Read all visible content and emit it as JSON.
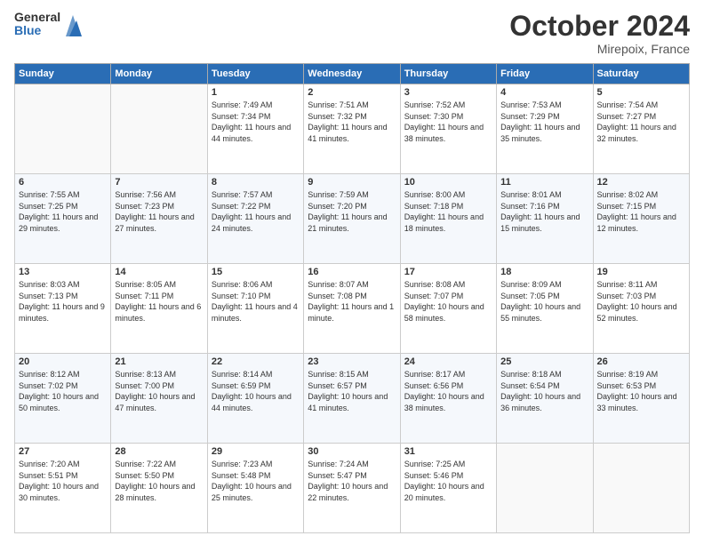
{
  "logo": {
    "general": "General",
    "blue": "Blue"
  },
  "header": {
    "month": "October 2024",
    "location": "Mirepoix, France"
  },
  "weekdays": [
    "Sunday",
    "Monday",
    "Tuesday",
    "Wednesday",
    "Thursday",
    "Friday",
    "Saturday"
  ],
  "weeks": [
    [
      {
        "day": "",
        "info": ""
      },
      {
        "day": "",
        "info": ""
      },
      {
        "day": "1",
        "info": "Sunrise: 7:49 AM\nSunset: 7:34 PM\nDaylight: 11 hours and 44 minutes."
      },
      {
        "day": "2",
        "info": "Sunrise: 7:51 AM\nSunset: 7:32 PM\nDaylight: 11 hours and 41 minutes."
      },
      {
        "day": "3",
        "info": "Sunrise: 7:52 AM\nSunset: 7:30 PM\nDaylight: 11 hours and 38 minutes."
      },
      {
        "day": "4",
        "info": "Sunrise: 7:53 AM\nSunset: 7:29 PM\nDaylight: 11 hours and 35 minutes."
      },
      {
        "day": "5",
        "info": "Sunrise: 7:54 AM\nSunset: 7:27 PM\nDaylight: 11 hours and 32 minutes."
      }
    ],
    [
      {
        "day": "6",
        "info": "Sunrise: 7:55 AM\nSunset: 7:25 PM\nDaylight: 11 hours and 29 minutes."
      },
      {
        "day": "7",
        "info": "Sunrise: 7:56 AM\nSunset: 7:23 PM\nDaylight: 11 hours and 27 minutes."
      },
      {
        "day": "8",
        "info": "Sunrise: 7:57 AM\nSunset: 7:22 PM\nDaylight: 11 hours and 24 minutes."
      },
      {
        "day": "9",
        "info": "Sunrise: 7:59 AM\nSunset: 7:20 PM\nDaylight: 11 hours and 21 minutes."
      },
      {
        "day": "10",
        "info": "Sunrise: 8:00 AM\nSunset: 7:18 PM\nDaylight: 11 hours and 18 minutes."
      },
      {
        "day": "11",
        "info": "Sunrise: 8:01 AM\nSunset: 7:16 PM\nDaylight: 11 hours and 15 minutes."
      },
      {
        "day": "12",
        "info": "Sunrise: 8:02 AM\nSunset: 7:15 PM\nDaylight: 11 hours and 12 minutes."
      }
    ],
    [
      {
        "day": "13",
        "info": "Sunrise: 8:03 AM\nSunset: 7:13 PM\nDaylight: 11 hours and 9 minutes."
      },
      {
        "day": "14",
        "info": "Sunrise: 8:05 AM\nSunset: 7:11 PM\nDaylight: 11 hours and 6 minutes."
      },
      {
        "day": "15",
        "info": "Sunrise: 8:06 AM\nSunset: 7:10 PM\nDaylight: 11 hours and 4 minutes."
      },
      {
        "day": "16",
        "info": "Sunrise: 8:07 AM\nSunset: 7:08 PM\nDaylight: 11 hours and 1 minute."
      },
      {
        "day": "17",
        "info": "Sunrise: 8:08 AM\nSunset: 7:07 PM\nDaylight: 10 hours and 58 minutes."
      },
      {
        "day": "18",
        "info": "Sunrise: 8:09 AM\nSunset: 7:05 PM\nDaylight: 10 hours and 55 minutes."
      },
      {
        "day": "19",
        "info": "Sunrise: 8:11 AM\nSunset: 7:03 PM\nDaylight: 10 hours and 52 minutes."
      }
    ],
    [
      {
        "day": "20",
        "info": "Sunrise: 8:12 AM\nSunset: 7:02 PM\nDaylight: 10 hours and 50 minutes."
      },
      {
        "day": "21",
        "info": "Sunrise: 8:13 AM\nSunset: 7:00 PM\nDaylight: 10 hours and 47 minutes."
      },
      {
        "day": "22",
        "info": "Sunrise: 8:14 AM\nSunset: 6:59 PM\nDaylight: 10 hours and 44 minutes."
      },
      {
        "day": "23",
        "info": "Sunrise: 8:15 AM\nSunset: 6:57 PM\nDaylight: 10 hours and 41 minutes."
      },
      {
        "day": "24",
        "info": "Sunrise: 8:17 AM\nSunset: 6:56 PM\nDaylight: 10 hours and 38 minutes."
      },
      {
        "day": "25",
        "info": "Sunrise: 8:18 AM\nSunset: 6:54 PM\nDaylight: 10 hours and 36 minutes."
      },
      {
        "day": "26",
        "info": "Sunrise: 8:19 AM\nSunset: 6:53 PM\nDaylight: 10 hours and 33 minutes."
      }
    ],
    [
      {
        "day": "27",
        "info": "Sunrise: 7:20 AM\nSunset: 5:51 PM\nDaylight: 10 hours and 30 minutes."
      },
      {
        "day": "28",
        "info": "Sunrise: 7:22 AM\nSunset: 5:50 PM\nDaylight: 10 hours and 28 minutes."
      },
      {
        "day": "29",
        "info": "Sunrise: 7:23 AM\nSunset: 5:48 PM\nDaylight: 10 hours and 25 minutes."
      },
      {
        "day": "30",
        "info": "Sunrise: 7:24 AM\nSunset: 5:47 PM\nDaylight: 10 hours and 22 minutes."
      },
      {
        "day": "31",
        "info": "Sunrise: 7:25 AM\nSunset: 5:46 PM\nDaylight: 10 hours and 20 minutes."
      },
      {
        "day": "",
        "info": ""
      },
      {
        "day": "",
        "info": ""
      }
    ]
  ]
}
